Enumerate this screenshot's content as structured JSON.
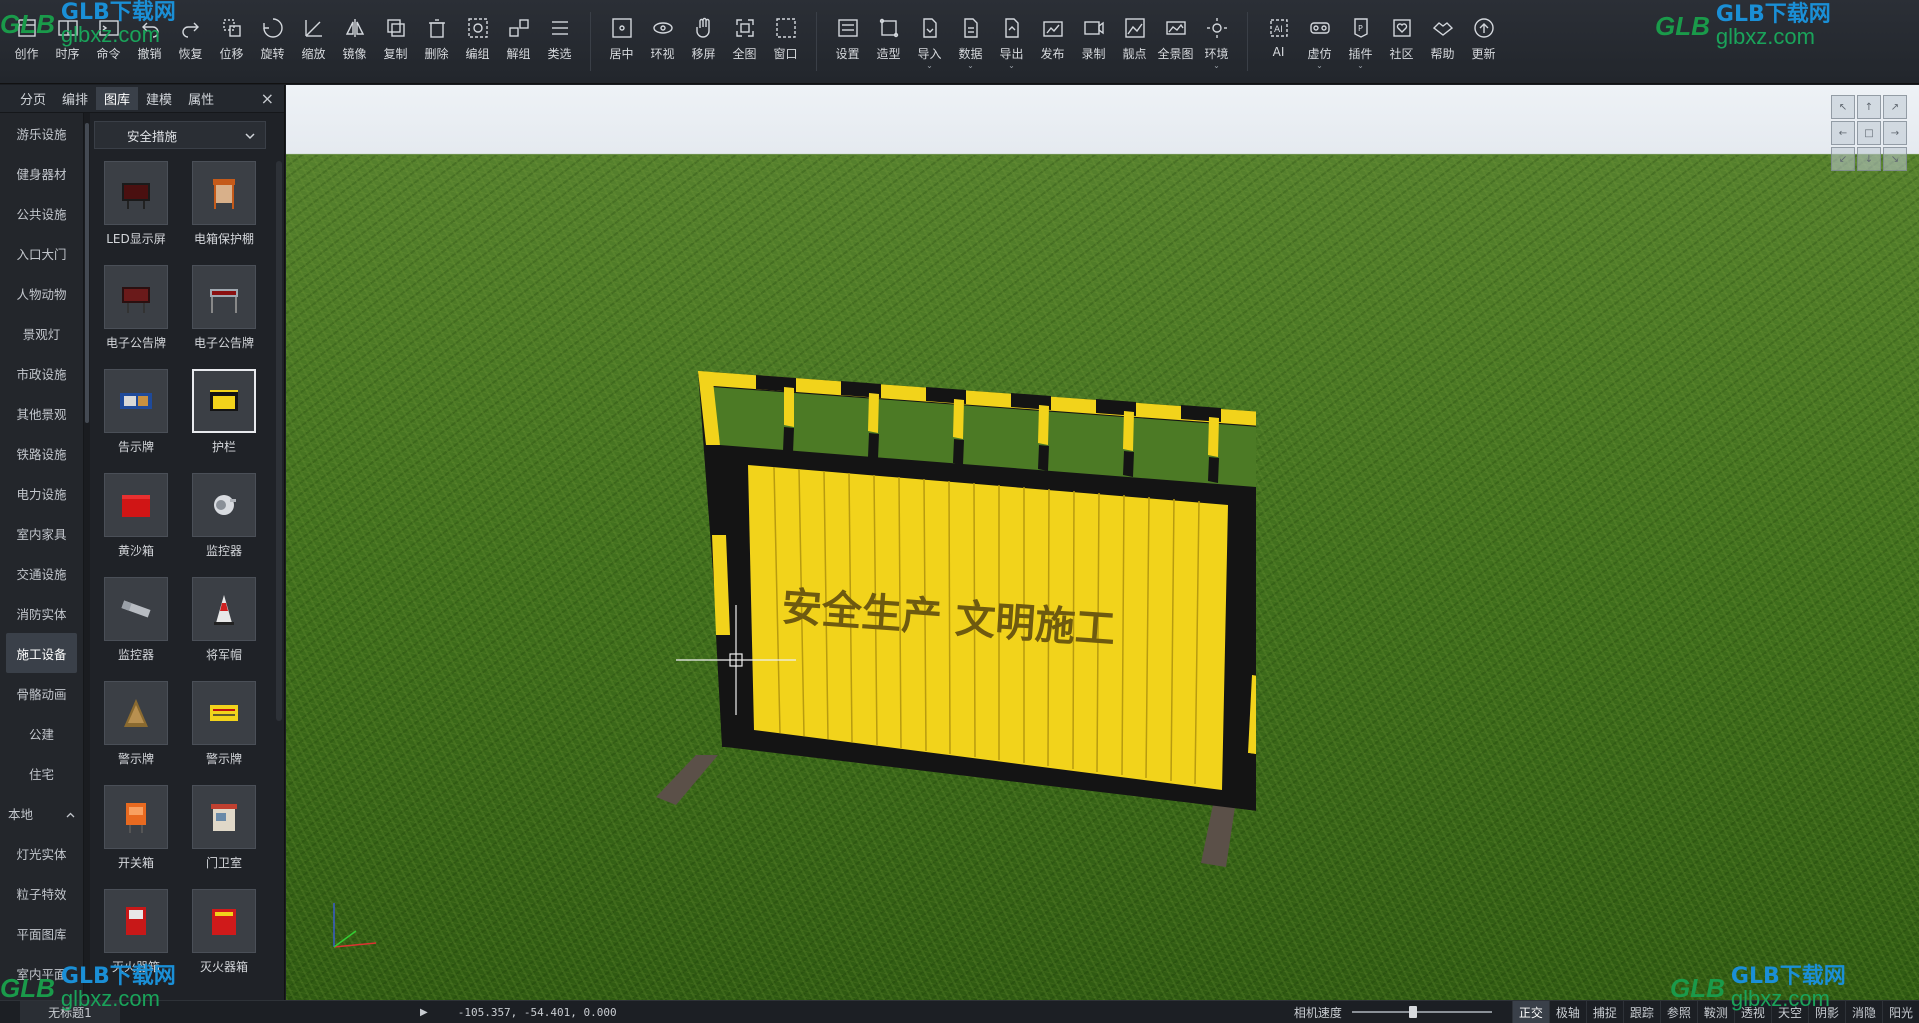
{
  "toolbar": {
    "groups": [
      [
        "创作",
        "时序",
        "命令",
        "撤销",
        "恢复",
        "位移",
        "旋转",
        "缩放",
        "镜像",
        "复制",
        "删除",
        "编组",
        "解组",
        "类选"
      ],
      [
        "居中",
        "环视",
        "移屏",
        "全图",
        "窗口"
      ],
      [
        "设置",
        "造型",
        "导入",
        "数据",
        "导出",
        "发布",
        "录制",
        "靓点",
        "全景图",
        "环境"
      ],
      [
        "AI",
        "虚仿",
        "插件",
        "社区",
        "帮助",
        "更新"
      ]
    ],
    "dropdown_items": [
      "导入",
      "数据",
      "导出",
      "环境",
      "虚仿",
      "插件"
    ]
  },
  "panel": {
    "tabs": [
      "分页",
      "编排",
      "图库",
      "建模",
      "属性"
    ],
    "active_tab": "图库",
    "close_label": "×",
    "categories": [
      "游乐设施",
      "健身器材",
      "公共设施",
      "入口大门",
      "人物动物",
      "景观灯",
      "市政设施",
      "其他景观",
      "铁路设施",
      "电力设施",
      "室内家具",
      "交通设施",
      "消防实体",
      "施工设备",
      "骨骼动画",
      "公建",
      "住宅"
    ],
    "active_category": "施工设备",
    "local_section": "本地",
    "local_categories": [
      "灯光实体",
      "粒子特效",
      "平面图库",
      "室内平面"
    ],
    "library_dropdown": "安全措施",
    "items": [
      {
        "name": "LED显示屏",
        "thumb": "led-screen"
      },
      {
        "name": "电箱保护棚",
        "thumb": "power-box-shelter"
      },
      {
        "name": "电子公告牌",
        "thumb": "electronic-board"
      },
      {
        "name": "电子公告牌",
        "thumb": "electronic-board-2"
      },
      {
        "name": "告示牌",
        "thumb": "notice-board"
      },
      {
        "name": "护栏",
        "thumb": "guardrail"
      },
      {
        "name": "黄沙箱",
        "thumb": "sand-box"
      },
      {
        "name": "监控器",
        "thumb": "camera"
      },
      {
        "name": "监控器",
        "thumb": "camera-2"
      },
      {
        "name": "将军帽",
        "thumb": "traffic-cone"
      },
      {
        "name": "警示牌",
        "thumb": "warning-sign"
      },
      {
        "name": "警示牌",
        "thumb": "warning-sign-2"
      },
      {
        "name": "开关箱",
        "thumb": "switch-box"
      },
      {
        "name": "门卫室",
        "thumb": "guard-room"
      },
      {
        "name": "灭火器箱",
        "thumb": "extinguisher-box"
      },
      {
        "name": "灭火器箱",
        "thumb": "extinguisher-box-2"
      }
    ],
    "selected_item": 5
  },
  "viewport": {
    "barrier_text": "安全生产 文明施工",
    "colors": {
      "barrier_yellow": "#f2d31b",
      "barrier_black": "#141414",
      "grass": "#3f6e1c",
      "sky": "#e8edf2"
    }
  },
  "statusbar": {
    "file_tab": "无标题1",
    "coords": "-105.357, -54.401, 0.000",
    "camera_speed_label": "相机速度",
    "camera_speed_value": 0.43,
    "modes": [
      {
        "label": "正交",
        "on": true
      },
      {
        "label": "极轴",
        "on": false
      },
      {
        "label": "捕捉",
        "on": false
      },
      {
        "label": "跟踪",
        "on": false
      },
      {
        "label": "参照",
        "on": false
      },
      {
        "label": "鞍测",
        "on": false
      },
      {
        "label": "透视",
        "on": false
      },
      {
        "label": "天空",
        "on": false
      },
      {
        "label": "阴影",
        "on": false
      },
      {
        "label": "消隐",
        "on": false
      },
      {
        "label": "阳光",
        "on": false
      }
    ]
  },
  "watermark": {
    "logo": "GLB",
    "title": "GLB下载网",
    "url": "glbxz.com"
  }
}
